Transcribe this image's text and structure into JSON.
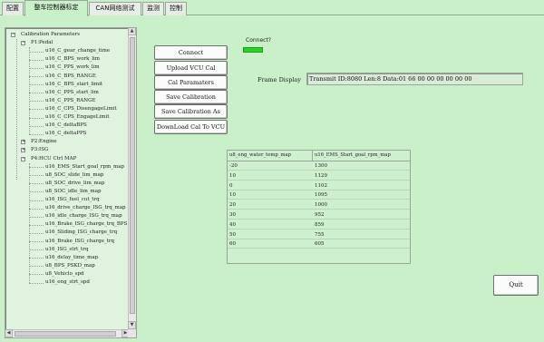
{
  "tabs": [
    {
      "label": "配置"
    },
    {
      "label": "整车控制器标定",
      "active": true
    },
    {
      "label": "CAN网络测试"
    },
    {
      "label": "监测"
    },
    {
      "label": "控制"
    }
  ],
  "tree": {
    "root": "Calibration Parameters",
    "groups": [
      {
        "label": "P1:Pedal",
        "expanded": true,
        "items": [
          "u16_C_gear_change_time",
          "u16_C_BPS_work_lim",
          "u16_C_PPS_work_lim",
          "u16_C_BPS_RANGE",
          "u16_C_BPS_start_limit",
          "u16_C_PPS_start_lim",
          "u16_C_PPS_RANGE",
          "u16_C_CPS_DisengageLimit",
          "u16_C_CPS_EngageLimit",
          "u16_C_deltaBPS",
          "u16_C_deltaPPS"
        ]
      },
      {
        "label": "P2:Engine",
        "expanded": false,
        "items": []
      },
      {
        "label": "P3:ISG",
        "expanded": false,
        "items": []
      },
      {
        "label": "P4:HCU Ctrl MAP",
        "expanded": true,
        "items": [
          "u16_EMS_Start_goal_rpm_map",
          "u8_SOC_slide_lim_map",
          "u8_SOC_drive_lim_map",
          "u8_SOC_idle_lim_map",
          "u16_ISG_fuel_cut_trq",
          "u16_drive_charge_ISG_trq_map",
          "u16_idle_charge_ISG_trq_map",
          "u16_Brake_ISG_charge_trq_BPS",
          "u16_Sliding_ISG_charge_trq",
          "u16_Brake_ISG_charge_trq",
          "u16_ISG_strt_trq",
          "u16_delay_time_map",
          "u8_BPS_PSKD_map",
          "u8_Vehiclo_spd",
          "u16_eng_strt_spd"
        ]
      }
    ]
  },
  "buttons": {
    "connect": "Connect",
    "upload": "Upload VCU Cal",
    "cal_params": "Cal Paramaters",
    "save_cal": "Save Calibration",
    "save_cal_as": "Save Calibration As",
    "download": "DownLoad Cal To VCU",
    "quit": "Quit"
  },
  "connect_status": {
    "label": "Connect?",
    "color": "#2bd02b"
  },
  "frame_display": {
    "label": "Frame Display",
    "value": "Transmit ID:8080 Len:8 Data:01 66 00 00 00 00 00 00"
  },
  "table": {
    "headers": [
      "u8_eng_water_temp_map",
      "u16_EMS_Start_goal_rpm_map"
    ],
    "rows": [
      [
        "-20",
        "1300"
      ],
      [
        "10",
        "1129"
      ],
      [
        "0",
        "1102"
      ],
      [
        "10",
        "1095"
      ],
      [
        "20",
        "1000"
      ],
      [
        "30",
        "952"
      ],
      [
        "40",
        "859"
      ],
      [
        "50",
        "755"
      ],
      [
        "60",
        "605"
      ]
    ]
  }
}
